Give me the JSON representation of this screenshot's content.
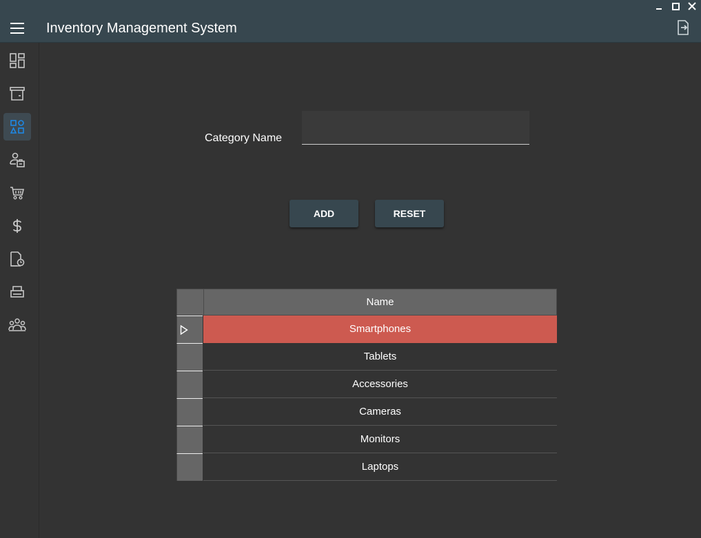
{
  "app": {
    "title": "Inventory Management System"
  },
  "sidebar": {
    "items": [
      {
        "icon": "dashboard-icon",
        "active": false
      },
      {
        "icon": "archive-icon",
        "active": false
      },
      {
        "icon": "categories-icon",
        "active": true
      },
      {
        "icon": "supplier-icon",
        "active": false
      },
      {
        "icon": "cart-icon",
        "active": false
      },
      {
        "icon": "dollar-icon",
        "active": false
      },
      {
        "icon": "report-icon",
        "active": false
      },
      {
        "icon": "printer-icon",
        "active": false
      },
      {
        "icon": "users-icon",
        "active": false
      }
    ]
  },
  "form": {
    "category_label": "Category Name",
    "category_value": "",
    "add_label": "ADD",
    "reset_label": "RESET"
  },
  "grid": {
    "columns": [
      "Name"
    ],
    "rows": [
      "Smartphones",
      "Tablets",
      "Accessories",
      "Cameras",
      "Monitors",
      "Laptops"
    ],
    "selected_index": 0
  },
  "colors": {
    "titlebar": "#37474f",
    "background": "#333333",
    "accent": "#1e88e5",
    "selected_row": "#cd5a50"
  }
}
